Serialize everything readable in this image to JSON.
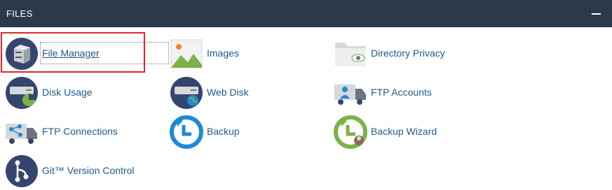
{
  "panel": {
    "title": "FILES"
  },
  "items": [
    {
      "label": "File Manager",
      "icon": "file-manager-icon"
    },
    {
      "label": "Images",
      "icon": "images-icon"
    },
    {
      "label": "Directory Privacy",
      "icon": "directory-privacy-icon"
    },
    {
      "label": "Disk Usage",
      "icon": "disk-usage-icon"
    },
    {
      "label": "Web Disk",
      "icon": "web-disk-icon"
    },
    {
      "label": "FTP Accounts",
      "icon": "ftp-accounts-icon"
    },
    {
      "label": "FTP Connections",
      "icon": "ftp-connections-icon"
    },
    {
      "label": "Backup",
      "icon": "backup-icon"
    },
    {
      "label": "Backup Wizard",
      "icon": "backup-wizard-icon"
    },
    {
      "label": "Git™ Version Control",
      "icon": "git-version-control-icon"
    }
  ],
  "colors": {
    "header_bg": "#2b3a4a",
    "link": "#1f5a8f",
    "highlight": "#e0262c",
    "icon_navy": "#35456e",
    "icon_blue": "#1e8ad6",
    "icon_green": "#7bb24a"
  }
}
